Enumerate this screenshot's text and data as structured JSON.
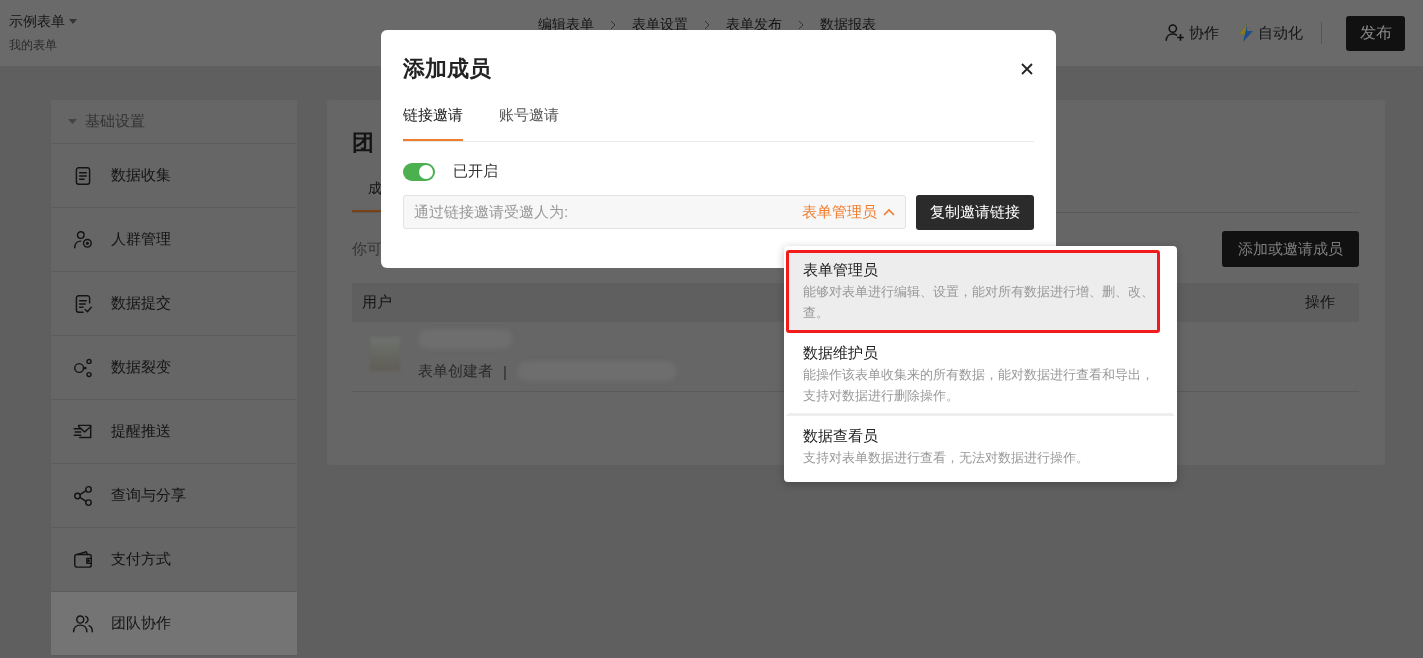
{
  "header": {
    "title": "示例表单",
    "subtitle": "我的表单",
    "steps": [
      {
        "label": "编辑表单"
      },
      {
        "label": "表单设置"
      },
      {
        "label": "表单发布"
      },
      {
        "label": "数据报表"
      }
    ],
    "actions": [
      {
        "kind": "collab",
        "label": "协作"
      },
      {
        "kind": "automation",
        "label": "自动化"
      }
    ],
    "publish": "发布"
  },
  "sidebar": {
    "section": "基础设置",
    "expanded": true,
    "items": [
      {
        "kind": "doc",
        "label": "数据收集",
        "selected": false
      },
      {
        "kind": "people",
        "label": "人群管理",
        "selected": false
      },
      {
        "kind": "submit",
        "label": "数据提交",
        "selected": false
      },
      {
        "kind": "fission",
        "label": "数据裂变",
        "selected": false
      },
      {
        "kind": "mail",
        "label": "提醒推送",
        "selected": false
      },
      {
        "kind": "share",
        "label": "查询与分享",
        "selected": false
      },
      {
        "kind": "wallet",
        "label": "支付方式",
        "selected": false
      },
      {
        "kind": "team",
        "label": "团队协作",
        "selected": true
      }
    ]
  },
  "main": {
    "title": "团",
    "tabs": [
      {
        "label": "成",
        "selected": true
      }
    ],
    "hint": "你可",
    "add_button": "添加或邀请成员",
    "table": {
      "columns": [
        "用户",
        "操作"
      ],
      "rows": [
        {
          "note": "表单创建者",
          "separator": "|"
        }
      ]
    }
  },
  "dialog": {
    "title": "添加成员",
    "tabs": [
      {
        "label": "链接邀请",
        "selected": true
      },
      {
        "label": "账号邀请",
        "selected": false
      }
    ],
    "link_toggle": {
      "on": true,
      "label": "已开启"
    },
    "role_field": {
      "label": "通过链接邀请受邀人为:",
      "value": "表单管理员",
      "expanded": true
    },
    "copy_button": "复制邀请链接"
  },
  "role_menu": {
    "options": [
      {
        "name": "表单管理员",
        "description": "能够对表单进行编辑、设置，能对所有数据进行增、删、改、查。",
        "selected": true,
        "outlined": true
      },
      {
        "name": "数据维护员",
        "description": "能操作该表单收集来的所有数据，能对数据进行查看和导出，支持对数据进行删除操作。",
        "selected": false,
        "outlined": false
      },
      {
        "name": "数据查看员",
        "description": "支持对表单数据进行查看，无法对数据进行操作。",
        "selected": false,
        "outlined": false
      }
    ]
  }
}
